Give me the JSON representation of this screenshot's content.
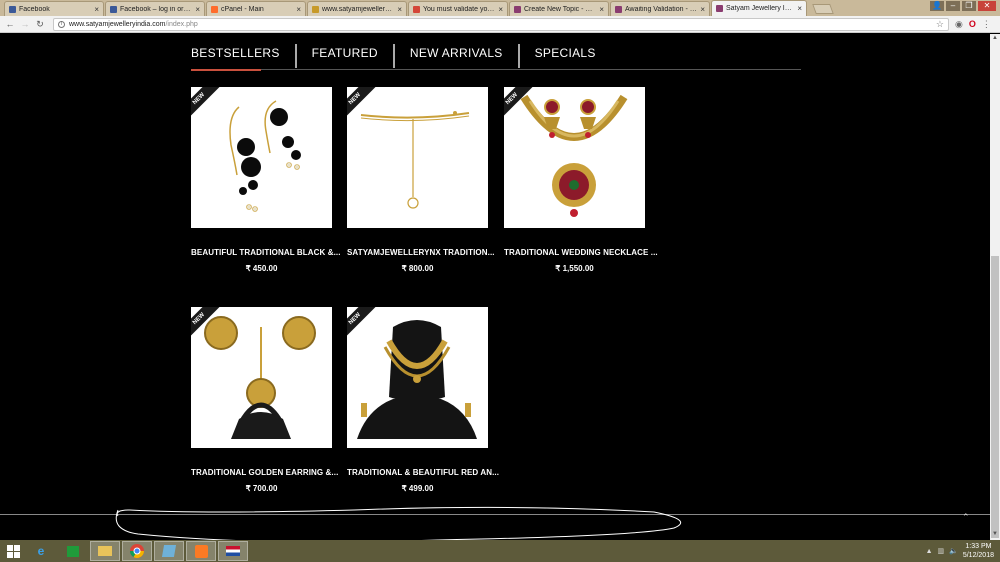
{
  "browser": {
    "tabs": [
      {
        "title": "Facebook",
        "color": "#3b5998"
      },
      {
        "title": "Facebook – log in or sig",
        "color": "#3b5998"
      },
      {
        "title": "cPanel - Main",
        "color": "#ff6c2c"
      },
      {
        "title": "www.satyamjewelleryind",
        "color": "#c79a2a"
      },
      {
        "title": "You must validate your a",
        "color": "#d44638"
      },
      {
        "title": "Create New Topic - Presi",
        "color": "#8a3c70"
      },
      {
        "title": "Awaiting Validation - Pre",
        "color": "#8a3c70"
      },
      {
        "title": "Satyam Jewellery India",
        "color": "#8a3c70",
        "active": true
      }
    ],
    "url_host": "www.satyamjewelleryindia.com",
    "url_path": "/index.php"
  },
  "page": {
    "tabs": [
      "BESTSELLERS",
      "FEATURED",
      "NEW ARRIVALS",
      "SPECIALS"
    ],
    "badge": "NEW",
    "products": [
      {
        "name": "BEAUTIFUL TRADITIONAL BLACK &...",
        "price": "₹ 450.00"
      },
      {
        "name": "SATYAMJEWELLERYNX TRADITION...",
        "price": "₹ 800.00"
      },
      {
        "name": "TRADITIONAL WEDDING NECKLACE ...",
        "price": "₹ 1,550.00"
      },
      {
        "name": "TRADITIONAL GOLDEN EARRING &...",
        "price": "₹ 700.00"
      },
      {
        "name": "TRADITIONAL & BEAUTIFUL RED AN...",
        "price": "₹ 499.00"
      }
    ]
  },
  "taskbar": {
    "time": "1:33 PM",
    "date": "5/12/2018"
  },
  "colors": {
    "accent": "#c9503d",
    "gold": "#c9a03a"
  }
}
